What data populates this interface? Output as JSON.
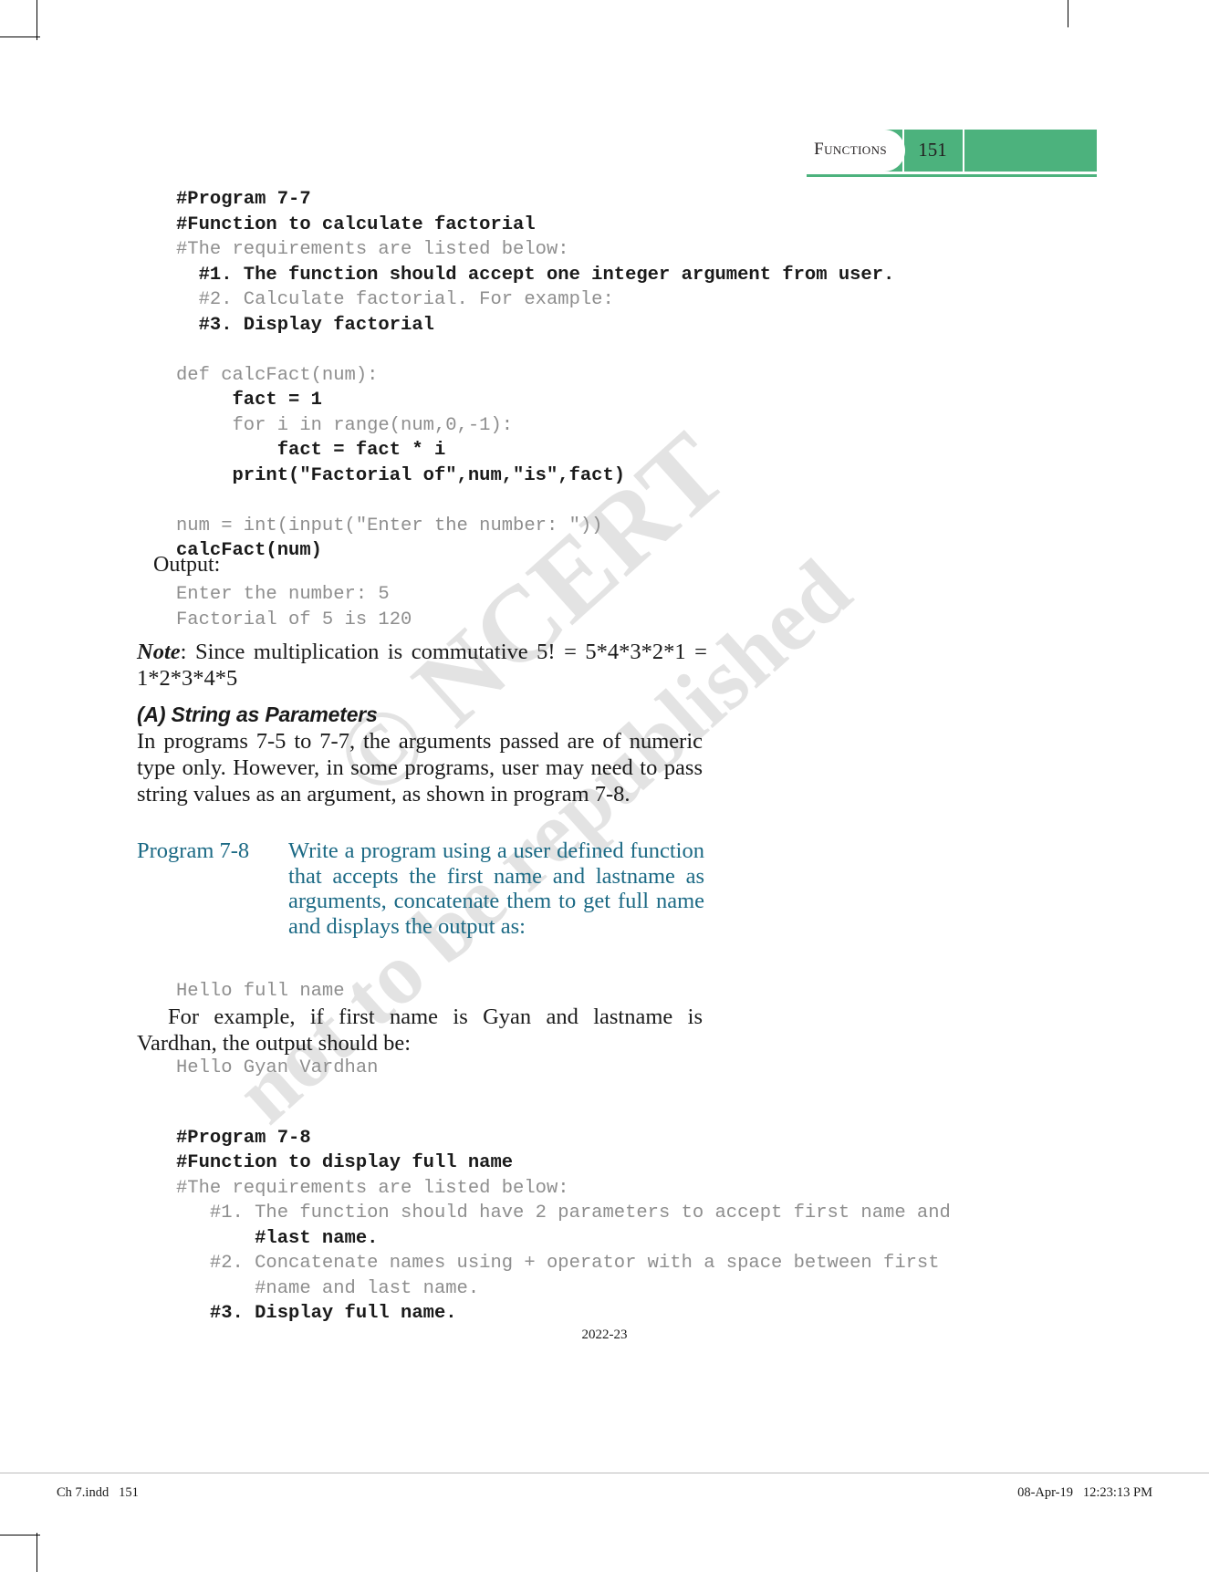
{
  "header": {
    "chapter_title": "Functions",
    "page_number": "151",
    "accent_color": "#4cb27d"
  },
  "watermark": {
    "line1": "© NCERT",
    "line2": "not to be republished"
  },
  "code_block_1": {
    "lines": [
      {
        "text": "#Program 7-7",
        "style": "dark"
      },
      {
        "text": "#Function to calculate factorial",
        "style": "dark"
      },
      {
        "text": "#The requirements are listed below:",
        "style": "light"
      },
      {
        "text": "  #1. The function should accept one integer argument from user.",
        "style": "dark"
      },
      {
        "text": "  #2. Calculate factorial. For example:",
        "style": "light"
      },
      {
        "text": "  #3. Display factorial",
        "style": "dark"
      },
      {
        "text": "",
        "style": "blank"
      },
      {
        "text": "def calcFact(num):",
        "style": "light"
      },
      {
        "text": "     fact = 1",
        "style": "dark"
      },
      {
        "text": "     for i in range(num,0,-1):",
        "style": "light"
      },
      {
        "text": "         fact = fact * i",
        "style": "dark"
      },
      {
        "text": "     print(\"Factorial of\",num,\"is\",fact)",
        "style": "dark"
      },
      {
        "text": "",
        "style": "blank"
      },
      {
        "text": "num = int(input(\"Enter the number: \"))",
        "style": "light"
      },
      {
        "text": "calcFact(num)",
        "style": "dark"
      }
    ]
  },
  "output_label": "Output:",
  "output_block_1": {
    "lines": [
      {
        "text": "Enter the number: 5",
        "style": "light"
      },
      {
        "text": "Factorial of 5 is 120",
        "style": "light"
      }
    ]
  },
  "note": {
    "label": "Note",
    "text": ": Since multiplication is commutative 5! = 5*4*3*2*1 = 1*2*3*4*5"
  },
  "section_heading": "(A) String as Parameters",
  "intro_paragraph": "In programs 7-5 to 7-7, the arguments passed are of numeric type only. However, in some programs, user may need to pass string values as an argument, as shown in program 7-8.",
  "program_78": {
    "label": "Program 7-8",
    "description": "Write a program using a user defined function that accepts the first name and lastname as arguments, concatenate them to get full name and displays the output as:",
    "color": "#1c6a85"
  },
  "hello_sample": {
    "lines": [
      {
        "text": "Hello full name",
        "style": "light"
      }
    ]
  },
  "example_paragraph": {
    "text": "For example, if first name is Gyan and lastname is Vardhan, the output should be:"
  },
  "hello_sample_2": {
    "lines": [
      {
        "text": "Hello Gyan Vardhan",
        "style": "light"
      }
    ]
  },
  "code_block_2": {
    "lines": [
      {
        "text": "#Program 7-8",
        "style": "dark"
      },
      {
        "text": "#Function to display full name",
        "style": "dark"
      },
      {
        "text": "#The requirements are listed below:",
        "style": "light"
      },
      {
        "text": "   #1. The function should have 2 parameters to accept first name and",
        "style": "light"
      },
      {
        "text": "       #last name.",
        "style": "dark"
      },
      {
        "text": "   #2. Concatenate names using + operator with a space between first",
        "style": "light"
      },
      {
        "text": "       #name and last name.",
        "style": "light"
      },
      {
        "text": "   #3. Display full name.",
        "style": "dark"
      }
    ]
  },
  "footer": {
    "year": "2022-23",
    "file_info": "Ch 7.indd   151",
    "timestamp": "08-Apr-19   12:23:13 PM"
  }
}
